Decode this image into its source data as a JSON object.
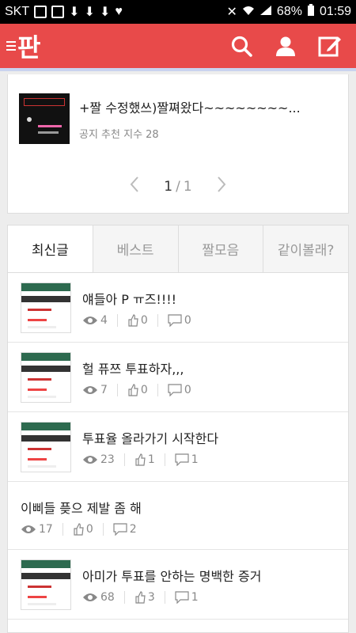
{
  "status_bar": {
    "carrier": "SKT",
    "battery": "68%",
    "time": "01:59"
  },
  "app": {
    "logo_text": "판",
    "accent_color": "#e84a4a"
  },
  "notice": {
    "title": "+짤 수정했쓰)짤쪄왔다~~~~~~~~...",
    "meta": "공지 추천 지수 28"
  },
  "pagination": {
    "current": "1",
    "separator": "/",
    "total": "1"
  },
  "tabs": [
    {
      "label": "최신글",
      "active": true
    },
    {
      "label": "베스트",
      "active": false
    },
    {
      "label": "짤모음",
      "active": false
    },
    {
      "label": "같이볼래?",
      "active": false
    }
  ],
  "posts": [
    {
      "title": "얘들아 P ㅠ즈!!!!",
      "views": "4",
      "likes": "0",
      "comments": "0",
      "has_image": true
    },
    {
      "title": "헐 퓨쯔 투표하자,,,",
      "views": "7",
      "likes": "0",
      "comments": "0",
      "has_image": true
    },
    {
      "title": "투표율 올라가기 시작한다",
      "views": "23",
      "likes": "1",
      "comments": "1",
      "has_image": true
    },
    {
      "title": "이삐들 픚으 제발 좀 해",
      "views": "17",
      "likes": "0",
      "comments": "2",
      "has_image": false
    },
    {
      "title": "아미가 투표를 안하는 명백한 증거",
      "views": "68",
      "likes": "3",
      "comments": "1",
      "has_image": true
    }
  ]
}
